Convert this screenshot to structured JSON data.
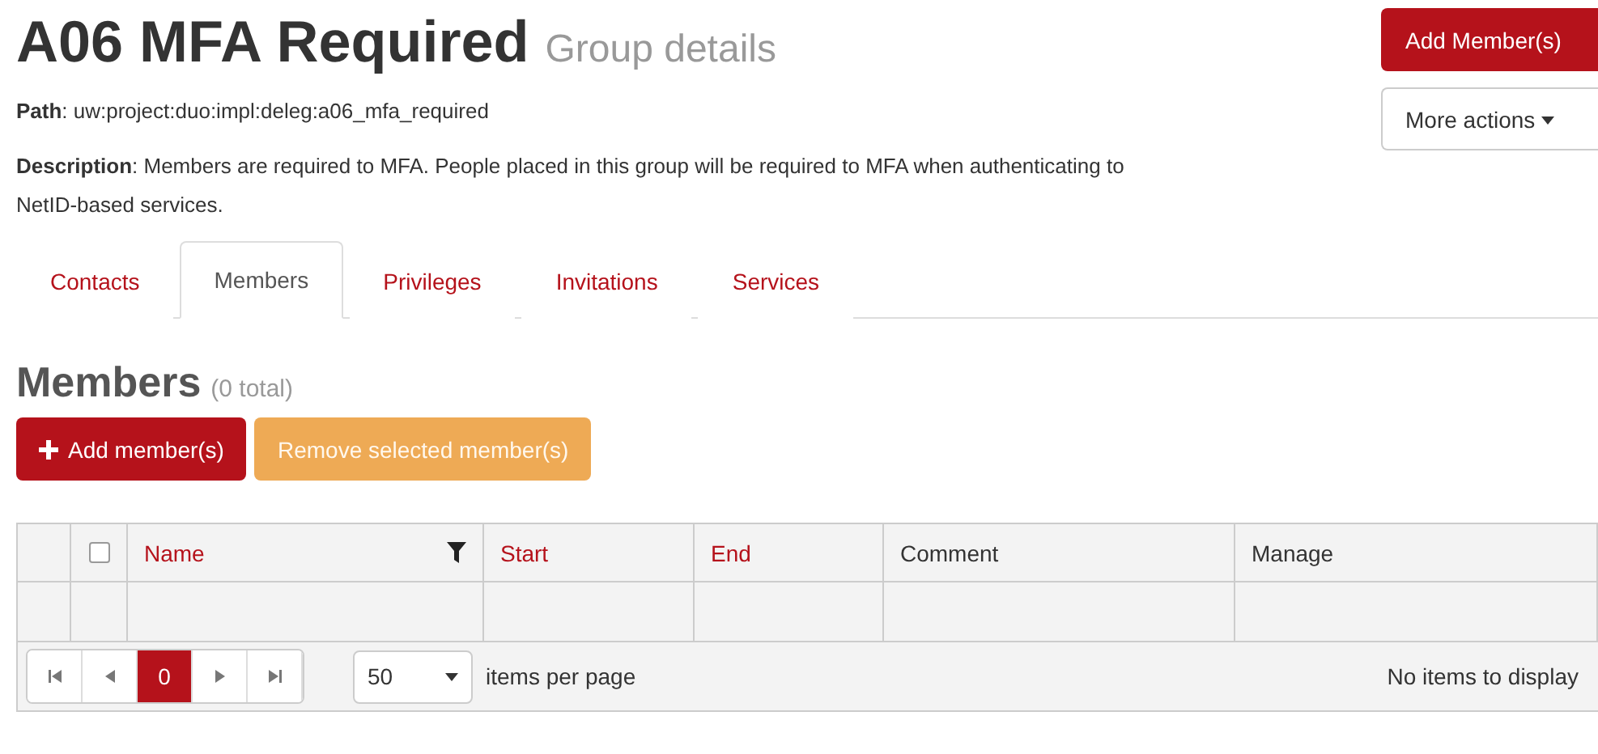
{
  "header": {
    "title": "A06 MFA Required",
    "subtitle": "Group details",
    "path": "**Path**: uw:project:duo:impl:deleg:a06_mfa_required",
    "description": "**Description**: Members are required to MFA. People placed in this group will be required to MFA when authenticating to NetID-based services."
  },
  "actions": [
    {
      "kind": "primary",
      "label": "Add Member(s)"
    },
    {
      "kind": "dropdown",
      "label": "More actions"
    }
  ],
  "tabs": [
    {
      "label": "Contacts",
      "selected": false
    },
    {
      "label": "Members",
      "selected": true
    },
    {
      "label": "Privileges",
      "selected": false
    },
    {
      "label": "Invitations",
      "selected": false
    },
    {
      "label": "Services",
      "selected": false
    }
  ],
  "section": {
    "title": "Members",
    "count": "(0 total)"
  },
  "buttons": [
    {
      "kind": "add",
      "label": "Add member(s)"
    },
    {
      "kind": "warning",
      "label": "Remove selected member(s)"
    }
  ],
  "table": {
    "select_all_checked": false,
    "columns": [
      {
        "label": "Name",
        "sortable": true,
        "filter": true
      },
      {
        "label": "Start",
        "sortable": true,
        "filter": false
      },
      {
        "label": "End",
        "sortable": true,
        "filter": false
      },
      {
        "label": "Comment",
        "sortable": false,
        "filter": false
      },
      {
        "label": "Manage",
        "sortable": false,
        "filter": false
      }
    ]
  },
  "pager": {
    "page": "0",
    "page_size": "50",
    "page_size_label": "items per page",
    "status": "No items to display"
  }
}
